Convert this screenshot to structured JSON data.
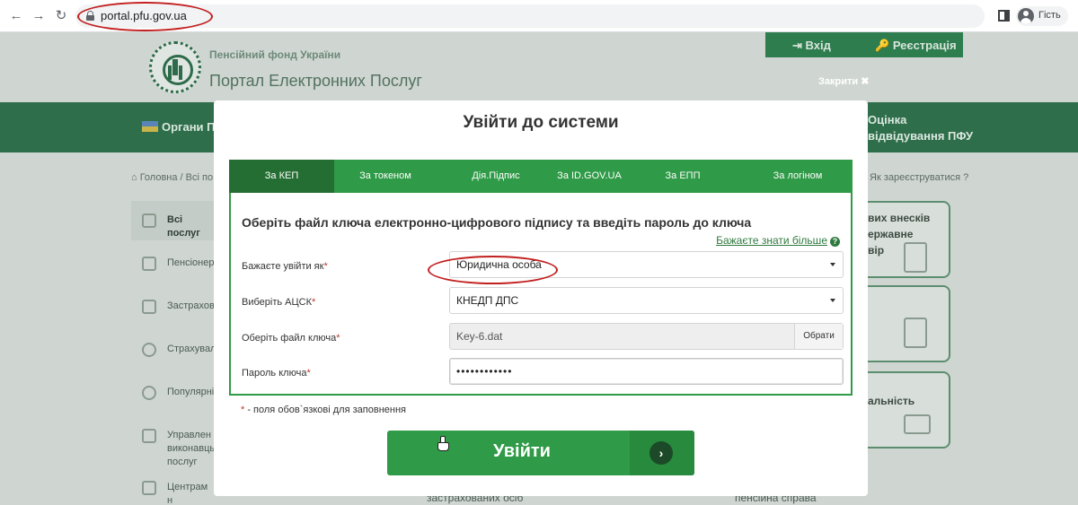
{
  "browser": {
    "url": "portal.pfu.gov.ua",
    "profile_label": "Гість"
  },
  "site": {
    "org_name": "Пенсійний фонд України",
    "portal_name": "Портал Електронних Послуг",
    "login_label": "Вхід",
    "register_label": "Реєстрація",
    "close_label": "Закрити ✖",
    "organs_label": "Органи П",
    "rate_label_1": "Оцінка",
    "rate_label_2": "відвідування ПФУ",
    "breadcrumb": "Головна / Всі по",
    "register_hint": "Як зареєструватися",
    "sidebar": [
      {
        "label": "Всі послуг"
      },
      {
        "label": "Пенсіонер"
      },
      {
        "label": "Застрахов"
      },
      {
        "label": "Страхувал"
      },
      {
        "label": "Популярні"
      },
      {
        "label": "Управлен\nвиконавць\nпослуг"
      },
      {
        "label": "Центрам н"
      }
    ],
    "right_cards": [
      {
        "text": "вих внесків\nержавне\nвір"
      },
      {
        "text": ""
      },
      {
        "text": "альність"
      }
    ],
    "bottom_text_1": "застрахованих осіб",
    "bottom_text_2": "пенсійна справа"
  },
  "modal": {
    "title": "Увійти до системи",
    "tabs": [
      {
        "label": "За КЕП",
        "active": true
      },
      {
        "label": "За токеном",
        "active": false
      },
      {
        "label": "Дія.Підпис",
        "active": false
      },
      {
        "label": "За ID.GOV.UA",
        "active": false
      },
      {
        "label": "За ЕПП",
        "active": false
      },
      {
        "label": "За логіном",
        "active": false
      }
    ],
    "heading": "Оберіть файл ключа електронно-цифрового підпису та введіть пароль до ключа",
    "learn_more": "Бажаєте знати більше",
    "fields": {
      "role_label": "Бажаєте увійти як",
      "role_value": "Юридична особа",
      "acsk_label": "Виберіть АЦСК",
      "acsk_value": "КНЕДП ДПС",
      "keyfile_label": "Оберіть файл ключа",
      "keyfile_value": "Key-6.dat",
      "browse_label": "Обрати",
      "password_label": "Пароль ключа",
      "password_value": "••••••••••••"
    },
    "required_marker": "*",
    "required_note": " - поля обов`язкові для заповнення",
    "submit_label": "Увійти",
    "submit_arrow": "›"
  },
  "colors": {
    "primary_green": "#2f9a47",
    "dark_green": "#246e33",
    "annotation_red": "#c21f1f"
  }
}
